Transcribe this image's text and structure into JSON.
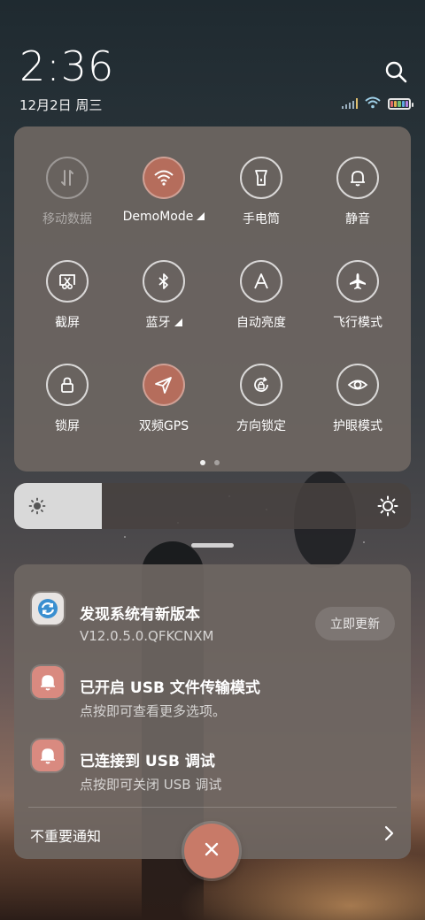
{
  "status": {
    "time": "2:36",
    "date": "12月2日 周三",
    "icons": [
      "signal-icon",
      "wifi-icon",
      "battery-icon"
    ]
  },
  "quick_settings": {
    "tiles": [
      {
        "label": "移动数据",
        "icon": "mobile-data-icon",
        "state": "disabled"
      },
      {
        "label": "DemoMode",
        "icon": "wifi-icon",
        "state": "active",
        "has_caret": true
      },
      {
        "label": "手电筒",
        "icon": "flashlight-icon",
        "state": "off"
      },
      {
        "label": "静音",
        "icon": "bell-icon",
        "state": "off"
      },
      {
        "label": "截屏",
        "icon": "screenshot-icon",
        "state": "off"
      },
      {
        "label": "蓝牙",
        "icon": "bluetooth-icon",
        "state": "off",
        "has_caret": true
      },
      {
        "label": "自动亮度",
        "icon": "auto-brightness-icon",
        "state": "off"
      },
      {
        "label": "飞行模式",
        "icon": "airplane-icon",
        "state": "off"
      },
      {
        "label": "锁屏",
        "icon": "lock-icon",
        "state": "off"
      },
      {
        "label": "双频GPS",
        "icon": "gps-icon",
        "state": "active"
      },
      {
        "label": "方向锁定",
        "icon": "rotation-lock-icon",
        "state": "off"
      },
      {
        "label": "护眼模式",
        "icon": "eye-icon",
        "state": "off"
      }
    ],
    "page_count": 2,
    "current_page": 1
  },
  "brightness": {
    "level": 0.22
  },
  "notifications": [
    {
      "title": "发现系统有新版本",
      "text": "V12.0.5.0.QFKCNXM",
      "icon": "update-icon",
      "action": "立即更新"
    },
    {
      "title": "已开启 USB 文件传输模式",
      "text": "点按即可查看更多选项。",
      "icon": "bell-icon"
    },
    {
      "title": "已连接到 USB 调试",
      "text": "点按即可关闭 USB 调试",
      "icon": "bell-icon"
    }
  ],
  "footer": {
    "label": "不重要通知"
  },
  "colors": {
    "accent": "#b56d5c",
    "panel": "#6e6662"
  }
}
